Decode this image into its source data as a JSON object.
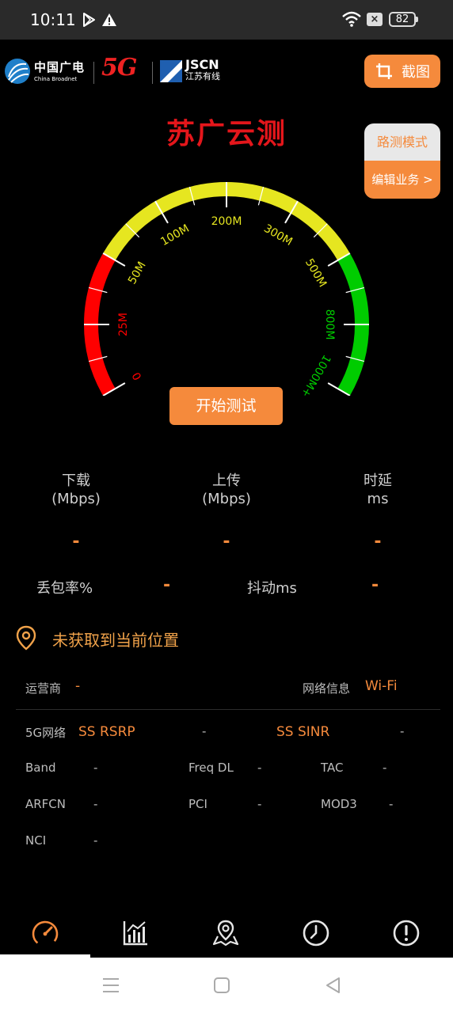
{
  "status_bar": {
    "time": "10:11",
    "battery": "82",
    "icons": [
      "play-store-icon",
      "warning-icon",
      "wifi-icon",
      "close-box-icon",
      "battery-icon"
    ]
  },
  "header": {
    "logo_china_broadnet_cn": "中国广电",
    "logo_china_broadnet_en": "China Broadnet",
    "logo_5g": "5G",
    "logo_jscn_en": "JSCN",
    "logo_jscn_cn": "江苏有线",
    "screenshot_label": "截图",
    "app_title": "苏广云测"
  },
  "mode_panel": {
    "road_test_mode": "路测模式",
    "edit_business": "编辑业务 >"
  },
  "gauge": {
    "ticks": [
      "0",
      "25M",
      "50M",
      "100M",
      "200M",
      "300M",
      "500M",
      "800M",
      "1000M+"
    ],
    "colors": {
      "red": "#ff0000",
      "yellow": "#e6e620",
      "green": "#00cc00"
    },
    "needle_value": null
  },
  "start_button": "开始测试",
  "metrics": {
    "download": {
      "label": "下载",
      "unit": "(Mbps)",
      "value": "-"
    },
    "upload": {
      "label": "上传",
      "unit": "(Mbps)",
      "value": "-"
    },
    "latency": {
      "label": "时延",
      "unit": "ms",
      "value": "-"
    },
    "packet_loss": {
      "label": "丢包率%",
      "value": "-"
    },
    "jitter": {
      "label": "抖动ms",
      "value": "-"
    }
  },
  "location": {
    "text": "未获取到当前位置"
  },
  "network": {
    "operator_label": "运营商",
    "operator_value": "-",
    "net_info_label": "网络信息",
    "net_info_value": "Wi-Fi",
    "fiveg_label": "5G网络",
    "ss_rsrp_label": "SS RSRP",
    "ss_rsrp_value": "-",
    "ss_sinr_label": "SS SINR",
    "ss_sinr_value": "-",
    "band_label": "Band",
    "band_value": "-",
    "freq_dl_label": "Freq DL",
    "freq_dl_value": "-",
    "tac_label": "TAC",
    "tac_value": "-",
    "arfcn_label": "ARFCN",
    "arfcn_value": "-",
    "pci_label": "PCI",
    "pci_value": "-",
    "mod3_label": "MOD3",
    "mod3_value": "-",
    "nci_label": "NCI",
    "nci_value": "-"
  },
  "tabs": [
    {
      "icon": "speedometer-icon",
      "active": true
    },
    {
      "icon": "bar-chart-icon",
      "active": false
    },
    {
      "icon": "map-pin-icon",
      "active": false
    },
    {
      "icon": "history-clock-icon",
      "active": false
    },
    {
      "icon": "info-exclamation-icon",
      "active": false
    }
  ],
  "colors": {
    "accent": "#f58a3c",
    "title_red": "#e4161b",
    "background": "#000000"
  }
}
